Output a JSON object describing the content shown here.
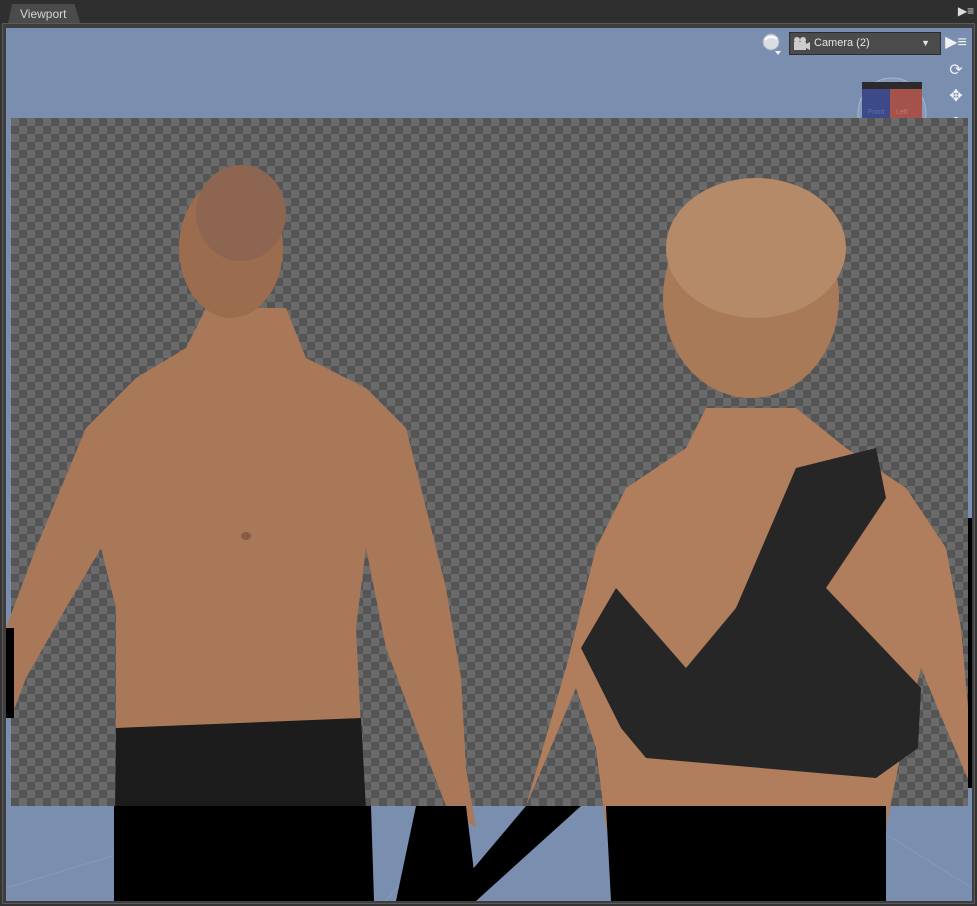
{
  "panel": {
    "tab_label": "Viewport",
    "menu_icon": "panel-menu-icon"
  },
  "toolbar": {
    "camera_select": "Camera (2)",
    "shading_icon": "draw-style-icon",
    "viewport_menu_icon": "viewport-options-icon",
    "orbit_icon": "orbit-icon",
    "pan_icon": "pan-icon",
    "dolly_icon": "dolly-icon"
  },
  "view_cube": {
    "faces": [
      "Front",
      "Left"
    ]
  },
  "colors": {
    "viewport_bg": "#7a8fb0",
    "skin": "#b07e5c",
    "clothing": "#262626"
  }
}
